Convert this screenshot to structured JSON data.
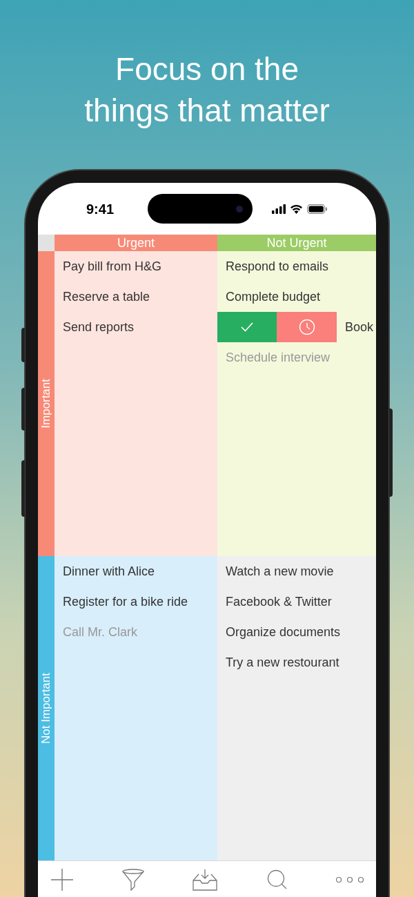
{
  "headline": [
    "Focus on the",
    "things that matter"
  ],
  "status_bar": {
    "time": "9:41"
  },
  "columns": [
    {
      "label": "Urgent",
      "color": "#f78a77"
    },
    {
      "label": "Not Urgent",
      "color": "#9ccc65"
    }
  ],
  "rows": [
    {
      "label": "Important",
      "color": "#f78a77"
    },
    {
      "label": "Not Important",
      "color": "#4cbde3"
    }
  ],
  "quadrants": [
    {
      "color": "#fde4df",
      "items": [
        {
          "kind": "task",
          "text": "Pay bill from H&G",
          "done": false
        },
        {
          "kind": "task",
          "text": "Reserve a table",
          "done": false
        },
        {
          "kind": "task",
          "text": "Send reports",
          "done": false
        }
      ]
    },
    {
      "color": "#f4f9dc",
      "items": [
        {
          "kind": "task",
          "text": "Respond to emails",
          "done": false
        },
        {
          "kind": "task",
          "text": "Complete budget",
          "done": false
        },
        {
          "kind": "swiped",
          "text": "Book",
          "done": false
        },
        {
          "kind": "task",
          "text": "Schedule interview",
          "done": true
        }
      ]
    },
    {
      "color": "#d9eefb",
      "items": [
        {
          "kind": "task",
          "text": "Dinner with Alice",
          "done": false
        },
        {
          "kind": "task",
          "text": "Register for a bike ride",
          "done": false
        },
        {
          "kind": "task",
          "text": "Call Mr. Clark",
          "done": true
        }
      ]
    },
    {
      "color": "#efefef",
      "items": [
        {
          "kind": "task",
          "text": "Watch a new movie",
          "done": false
        },
        {
          "kind": "task",
          "text": "Facebook & Twitter",
          "done": false
        },
        {
          "kind": "task",
          "text": "Organize documents",
          "done": false
        },
        {
          "kind": "task",
          "text": "Try a new restourant",
          "done": false
        }
      ]
    }
  ]
}
